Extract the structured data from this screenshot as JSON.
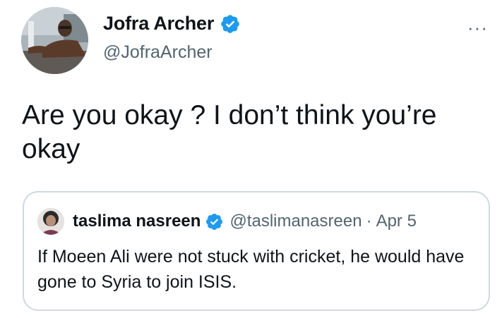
{
  "tweet": {
    "author": {
      "name": "Jofra Archer",
      "handle": "@JofraArcher"
    },
    "more_label": "···",
    "text": "Are you okay ? I don’t think you’re okay"
  },
  "quoted_tweet": {
    "author": {
      "name": "taslima nasreen",
      "handle": "@taslimanasreen"
    },
    "separator": "·",
    "date": "Apr 5",
    "text": "If Moeen Ali were not stuck with cricket,  he would have gone to Syria to join ISIS."
  },
  "colors": {
    "verified_badge": "#1d9bf0",
    "secondary_text": "#536471",
    "border": "#cfd9de"
  },
  "icons": {
    "verified": "verified-badge-icon",
    "more": "more-options-icon"
  }
}
